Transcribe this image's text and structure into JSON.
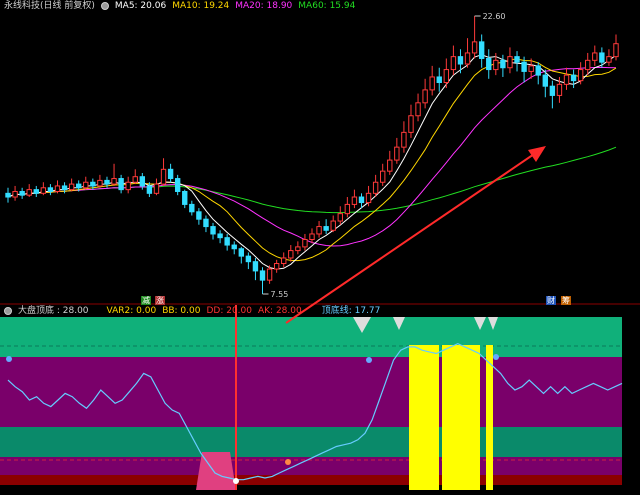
{
  "main_header": {
    "title": "永线科技(日线 前复权)",
    "ma5": {
      "label": "MA5: 20.06",
      "color": "#ffffff"
    },
    "ma10": {
      "label": "MA10: 19.24",
      "color": "#ffd700"
    },
    "ma20": {
      "label": "MA20: 18.90",
      "color": "#ff33ff"
    },
    "ma60": {
      "label": "MA60: 15.94",
      "color": "#22dd22"
    }
  },
  "ind_header": {
    "title": "大盘顶底 : 28.00",
    "var2": {
      "label": "VAR2: 0.00",
      "color": "#ffd700"
    },
    "bb": {
      "label": "BB: 0.00",
      "color": "#ffd700"
    },
    "dd": {
      "label": "DD: 20.00",
      "color": "#ff3333"
    },
    "ak": {
      "label": "AK: 28.00",
      "color": "#ff3333"
    },
    "line": {
      "label": "顶底线: 17.77",
      "color": "#66ccff"
    }
  },
  "tags": {
    "jian": "减",
    "zhang": "涨",
    "cai": "财",
    "chou": "筹"
  },
  "chart_data": {
    "type": "candlestick",
    "price_labels": {
      "high": "22.60",
      "low": "7.55"
    },
    "high": 22.6,
    "low": 7.55,
    "colors": {
      "up": "#ff3a3a",
      "down": "#33ddff",
      "ma5": "#ffffff",
      "ma10": "#ffd700",
      "ma20": "#ff33ff",
      "ma60": "#22dd22",
      "indicator": "#66ccff"
    },
    "candles": [
      [
        13.0,
        12.8,
        13.3,
        12.5
      ],
      [
        12.8,
        13.1,
        13.4,
        12.6
      ],
      [
        13.1,
        12.9,
        13.3,
        12.7
      ],
      [
        12.9,
        13.2,
        13.5,
        12.8
      ],
      [
        13.2,
        13.0,
        13.4,
        12.8
      ],
      [
        13.0,
        13.3,
        13.6,
        12.9
      ],
      [
        13.3,
        13.1,
        13.5,
        12.9
      ],
      [
        13.1,
        13.4,
        13.7,
        13.0
      ],
      [
        13.4,
        13.2,
        13.6,
        13.0
      ],
      [
        13.2,
        13.5,
        13.8,
        13.1
      ],
      [
        13.5,
        13.3,
        13.7,
        13.1
      ],
      [
        13.3,
        13.6,
        13.9,
        13.2
      ],
      [
        13.6,
        13.4,
        13.8,
        13.2
      ],
      [
        13.4,
        13.7,
        14.0,
        13.3
      ],
      [
        13.7,
        13.5,
        13.9,
        13.3
      ],
      [
        13.5,
        13.8,
        14.6,
        13.4
      ],
      [
        13.8,
        13.2,
        14.0,
        13.0
      ],
      [
        13.2,
        13.6,
        13.9,
        13.0
      ],
      [
        13.6,
        13.9,
        14.3,
        13.5
      ],
      [
        13.9,
        13.4,
        14.1,
        13.2
      ],
      [
        13.4,
        13.0,
        13.6,
        12.8
      ],
      [
        13.0,
        13.5,
        13.8,
        12.9
      ],
      [
        13.5,
        14.3,
        14.9,
        13.4
      ],
      [
        14.3,
        13.8,
        14.6,
        13.6
      ],
      [
        13.8,
        13.1,
        14.0,
        12.9
      ],
      [
        13.1,
        12.4,
        13.2,
        12.2
      ],
      [
        12.4,
        12.0,
        12.6,
        11.8
      ],
      [
        12.0,
        11.6,
        12.2,
        11.3
      ],
      [
        11.6,
        11.2,
        11.8,
        10.9
      ],
      [
        11.2,
        10.8,
        11.4,
        10.5
      ],
      [
        10.8,
        10.6,
        11.0,
        10.3
      ],
      [
        10.6,
        10.2,
        10.8,
        9.9
      ],
      [
        10.2,
        10.0,
        10.4,
        9.7
      ],
      [
        10.0,
        9.6,
        10.1,
        9.2
      ],
      [
        9.6,
        9.3,
        9.8,
        8.9
      ],
      [
        9.3,
        8.8,
        9.5,
        8.3
      ],
      [
        8.8,
        8.3,
        9.0,
        7.55
      ],
      [
        8.3,
        8.9,
        9.1,
        8.1
      ],
      [
        8.9,
        9.2,
        9.4,
        8.7
      ],
      [
        9.2,
        9.5,
        9.8,
        9.0
      ],
      [
        9.5,
        9.9,
        10.2,
        9.3
      ],
      [
        9.9,
        10.1,
        10.4,
        9.7
      ],
      [
        10.1,
        10.5,
        10.8,
        9.9
      ],
      [
        10.5,
        10.8,
        11.1,
        10.3
      ],
      [
        10.8,
        11.2,
        11.5,
        10.6
      ],
      [
        11.2,
        11.0,
        11.6,
        10.8
      ],
      [
        11.0,
        11.5,
        11.8,
        10.9
      ],
      [
        11.5,
        11.9,
        12.3,
        11.3
      ],
      [
        11.9,
        12.4,
        12.8,
        11.7
      ],
      [
        12.4,
        12.8,
        13.2,
        12.2
      ],
      [
        12.8,
        12.5,
        13.0,
        12.2
      ],
      [
        12.5,
        13.0,
        13.4,
        12.3
      ],
      [
        13.0,
        13.6,
        14.0,
        12.8
      ],
      [
        13.6,
        14.2,
        14.6,
        13.4
      ],
      [
        14.2,
        14.8,
        15.3,
        14.0
      ],
      [
        14.8,
        15.5,
        16.0,
        14.6
      ],
      [
        15.5,
        16.3,
        16.9,
        15.2
      ],
      [
        16.3,
        17.2,
        17.8,
        16.0
      ],
      [
        17.2,
        17.9,
        18.4,
        16.9
      ],
      [
        17.9,
        18.6,
        19.2,
        17.6
      ],
      [
        18.6,
        19.3,
        19.9,
        18.3
      ],
      [
        19.3,
        19.0,
        19.8,
        18.5
      ],
      [
        19.0,
        19.7,
        20.3,
        18.7
      ],
      [
        19.7,
        20.4,
        21.0,
        19.4
      ],
      [
        20.4,
        20.0,
        20.8,
        19.5
      ],
      [
        20.0,
        20.6,
        21.4,
        19.8
      ],
      [
        20.6,
        21.2,
        22.6,
        20.3
      ],
      [
        21.2,
        20.3,
        21.6,
        19.8
      ],
      [
        20.3,
        19.7,
        20.8,
        19.2
      ],
      [
        19.7,
        20.2,
        20.6,
        19.4
      ],
      [
        20.2,
        19.8,
        20.5,
        19.3
      ],
      [
        19.8,
        20.4,
        20.9,
        19.5
      ],
      [
        20.4,
        20.1,
        20.7,
        19.6
      ],
      [
        20.1,
        19.6,
        20.4,
        19.0
      ],
      [
        19.6,
        19.9,
        20.3,
        19.2
      ],
      [
        19.9,
        19.4,
        20.1,
        18.9
      ],
      [
        19.4,
        18.8,
        19.7,
        18.2
      ],
      [
        18.8,
        18.3,
        19.1,
        17.6
      ],
      [
        18.3,
        18.9,
        19.3,
        17.9
      ],
      [
        18.9,
        19.4,
        19.8,
        18.6
      ],
      [
        19.4,
        19.1,
        19.7,
        18.7
      ],
      [
        19.1,
        19.7,
        20.1,
        18.9
      ],
      [
        19.7,
        20.2,
        20.6,
        19.4
      ],
      [
        20.2,
        20.6,
        21.0,
        19.9
      ],
      [
        20.6,
        20.1,
        20.9,
        19.8
      ],
      [
        20.1,
        20.4,
        20.8,
        19.9
      ],
      [
        20.4,
        21.1,
        21.6,
        20.2
      ]
    ],
    "indicator_values": [
      62,
      58,
      55,
      50,
      52,
      48,
      46,
      50,
      54,
      52,
      48,
      45,
      50,
      56,
      52,
      48,
      50,
      55,
      60,
      66,
      64,
      56,
      48,
      44,
      42,
      34,
      26,
      18,
      12,
      6,
      4,
      3,
      2,
      2,
      3,
      4,
      3,
      4,
      6,
      8,
      10,
      12,
      14,
      16,
      18,
      20,
      22,
      23,
      24,
      26,
      30,
      38,
      50,
      62,
      74,
      80,
      82,
      82,
      80,
      79,
      78,
      80,
      82,
      84,
      82,
      80,
      78,
      74,
      70,
      66,
      60,
      56,
      58,
      62,
      58,
      54,
      58,
      54,
      58,
      54,
      56,
      58,
      60,
      58,
      56,
      58,
      60
    ]
  }
}
